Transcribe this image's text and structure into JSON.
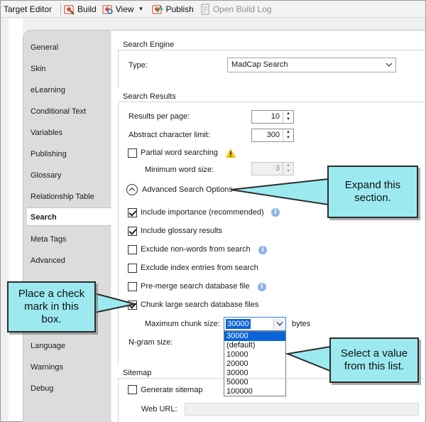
{
  "toolbar": {
    "title": "Target Editor",
    "build": "Build",
    "view": "View",
    "publish": "Publish",
    "open_build_log": "Open Build Log"
  },
  "tabs": [
    "General",
    "Skin",
    "eLearning",
    "Conditional Text",
    "Variables",
    "Publishing",
    "Glossary",
    "Relationship Table",
    "Search",
    "Meta Tags",
    "Advanced",
    "Language",
    "Warnings",
    "Debug"
  ],
  "active_tab": "Search",
  "search_engine": {
    "group": "Search Engine",
    "type_label": "Type:",
    "type_value": "MadCap Search"
  },
  "search_results": {
    "group": "Search Results",
    "results_per_page_label": "Results per page:",
    "results_per_page": "10",
    "abstract_limit_label": "Abstract character limit:",
    "abstract_limit": "300",
    "partial_word_label": "Partial word searching",
    "partial_word_checked": false,
    "min_word_size_label": "Minimum word size:",
    "min_word_size": "3"
  },
  "advanced": {
    "expander_label": "Advanced Search Options",
    "include_importance": "Include importance (recommended)",
    "include_importance_checked": true,
    "include_glossary": "Include glossary results",
    "include_glossary_checked": true,
    "exclude_non_words": "Exclude non-words from search",
    "exclude_non_words_checked": false,
    "exclude_index": "Exclude index entries from search",
    "exclude_index_checked": false,
    "pre_merge": "Pre-merge search database file",
    "pre_merge_checked": false,
    "chunk_large": "Chunk large search database files",
    "chunk_large_checked": true,
    "max_chunk_label": "Maximum chunk size:",
    "max_chunk_value": "30000",
    "bytes_label": "bytes",
    "chunk_options": [
      "30000",
      "(default)",
      "10000",
      "20000",
      "30000",
      "50000",
      "100000"
    ],
    "ngram_label": "N-gram size:"
  },
  "sitemap": {
    "group": "Sitemap",
    "generate_label": "Generate sitemap",
    "generate_checked": false,
    "web_url_label": "Web URL:",
    "web_url_value": ""
  },
  "callouts": {
    "expand": "Expand this section.",
    "check": "Place a check mark in this box.",
    "select": "Select a value from this list."
  },
  "colors": {
    "callout_fill": "#9ceaf0",
    "selection": "#0a64d8",
    "info_icon": "#8ab4e6",
    "warning_icon": "#f2c500"
  }
}
